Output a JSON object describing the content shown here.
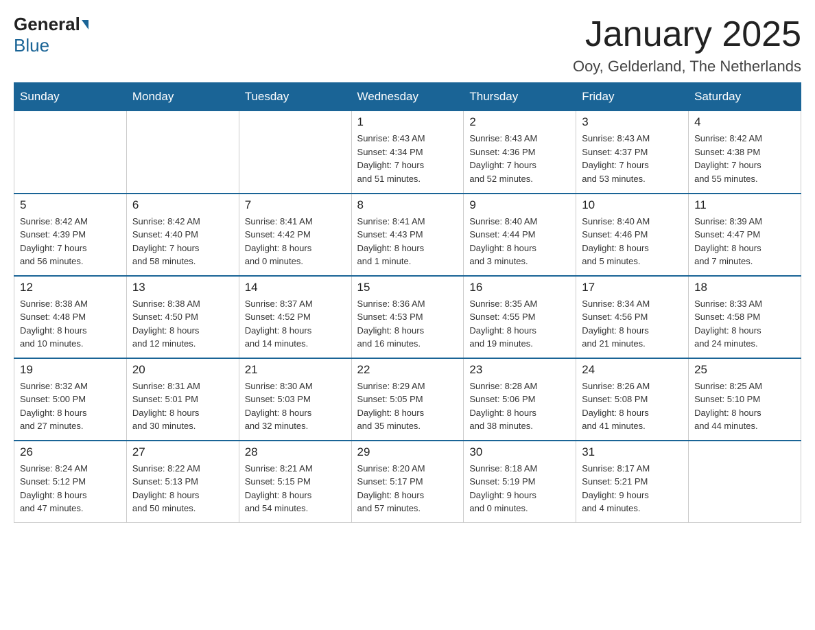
{
  "header": {
    "logo": {
      "general": "General",
      "blue": "Blue"
    },
    "title": "January 2025",
    "location": "Ooy, Gelderland, The Netherlands"
  },
  "weekdays": [
    "Sunday",
    "Monday",
    "Tuesday",
    "Wednesday",
    "Thursday",
    "Friday",
    "Saturday"
  ],
  "weeks": [
    [
      {
        "day": "",
        "info": ""
      },
      {
        "day": "",
        "info": ""
      },
      {
        "day": "",
        "info": ""
      },
      {
        "day": "1",
        "info": "Sunrise: 8:43 AM\nSunset: 4:34 PM\nDaylight: 7 hours\nand 51 minutes."
      },
      {
        "day": "2",
        "info": "Sunrise: 8:43 AM\nSunset: 4:36 PM\nDaylight: 7 hours\nand 52 minutes."
      },
      {
        "day": "3",
        "info": "Sunrise: 8:43 AM\nSunset: 4:37 PM\nDaylight: 7 hours\nand 53 minutes."
      },
      {
        "day": "4",
        "info": "Sunrise: 8:42 AM\nSunset: 4:38 PM\nDaylight: 7 hours\nand 55 minutes."
      }
    ],
    [
      {
        "day": "5",
        "info": "Sunrise: 8:42 AM\nSunset: 4:39 PM\nDaylight: 7 hours\nand 56 minutes."
      },
      {
        "day": "6",
        "info": "Sunrise: 8:42 AM\nSunset: 4:40 PM\nDaylight: 7 hours\nand 58 minutes."
      },
      {
        "day": "7",
        "info": "Sunrise: 8:41 AM\nSunset: 4:42 PM\nDaylight: 8 hours\nand 0 minutes."
      },
      {
        "day": "8",
        "info": "Sunrise: 8:41 AM\nSunset: 4:43 PM\nDaylight: 8 hours\nand 1 minute."
      },
      {
        "day": "9",
        "info": "Sunrise: 8:40 AM\nSunset: 4:44 PM\nDaylight: 8 hours\nand 3 minutes."
      },
      {
        "day": "10",
        "info": "Sunrise: 8:40 AM\nSunset: 4:46 PM\nDaylight: 8 hours\nand 5 minutes."
      },
      {
        "day": "11",
        "info": "Sunrise: 8:39 AM\nSunset: 4:47 PM\nDaylight: 8 hours\nand 7 minutes."
      }
    ],
    [
      {
        "day": "12",
        "info": "Sunrise: 8:38 AM\nSunset: 4:48 PM\nDaylight: 8 hours\nand 10 minutes."
      },
      {
        "day": "13",
        "info": "Sunrise: 8:38 AM\nSunset: 4:50 PM\nDaylight: 8 hours\nand 12 minutes."
      },
      {
        "day": "14",
        "info": "Sunrise: 8:37 AM\nSunset: 4:52 PM\nDaylight: 8 hours\nand 14 minutes."
      },
      {
        "day": "15",
        "info": "Sunrise: 8:36 AM\nSunset: 4:53 PM\nDaylight: 8 hours\nand 16 minutes."
      },
      {
        "day": "16",
        "info": "Sunrise: 8:35 AM\nSunset: 4:55 PM\nDaylight: 8 hours\nand 19 minutes."
      },
      {
        "day": "17",
        "info": "Sunrise: 8:34 AM\nSunset: 4:56 PM\nDaylight: 8 hours\nand 21 minutes."
      },
      {
        "day": "18",
        "info": "Sunrise: 8:33 AM\nSunset: 4:58 PM\nDaylight: 8 hours\nand 24 minutes."
      }
    ],
    [
      {
        "day": "19",
        "info": "Sunrise: 8:32 AM\nSunset: 5:00 PM\nDaylight: 8 hours\nand 27 minutes."
      },
      {
        "day": "20",
        "info": "Sunrise: 8:31 AM\nSunset: 5:01 PM\nDaylight: 8 hours\nand 30 minutes."
      },
      {
        "day": "21",
        "info": "Sunrise: 8:30 AM\nSunset: 5:03 PM\nDaylight: 8 hours\nand 32 minutes."
      },
      {
        "day": "22",
        "info": "Sunrise: 8:29 AM\nSunset: 5:05 PM\nDaylight: 8 hours\nand 35 minutes."
      },
      {
        "day": "23",
        "info": "Sunrise: 8:28 AM\nSunset: 5:06 PM\nDaylight: 8 hours\nand 38 minutes."
      },
      {
        "day": "24",
        "info": "Sunrise: 8:26 AM\nSunset: 5:08 PM\nDaylight: 8 hours\nand 41 minutes."
      },
      {
        "day": "25",
        "info": "Sunrise: 8:25 AM\nSunset: 5:10 PM\nDaylight: 8 hours\nand 44 minutes."
      }
    ],
    [
      {
        "day": "26",
        "info": "Sunrise: 8:24 AM\nSunset: 5:12 PM\nDaylight: 8 hours\nand 47 minutes."
      },
      {
        "day": "27",
        "info": "Sunrise: 8:22 AM\nSunset: 5:13 PM\nDaylight: 8 hours\nand 50 minutes."
      },
      {
        "day": "28",
        "info": "Sunrise: 8:21 AM\nSunset: 5:15 PM\nDaylight: 8 hours\nand 54 minutes."
      },
      {
        "day": "29",
        "info": "Sunrise: 8:20 AM\nSunset: 5:17 PM\nDaylight: 8 hours\nand 57 minutes."
      },
      {
        "day": "30",
        "info": "Sunrise: 8:18 AM\nSunset: 5:19 PM\nDaylight: 9 hours\nand 0 minutes."
      },
      {
        "day": "31",
        "info": "Sunrise: 8:17 AM\nSunset: 5:21 PM\nDaylight: 9 hours\nand 4 minutes."
      },
      {
        "day": "",
        "info": ""
      }
    ]
  ]
}
